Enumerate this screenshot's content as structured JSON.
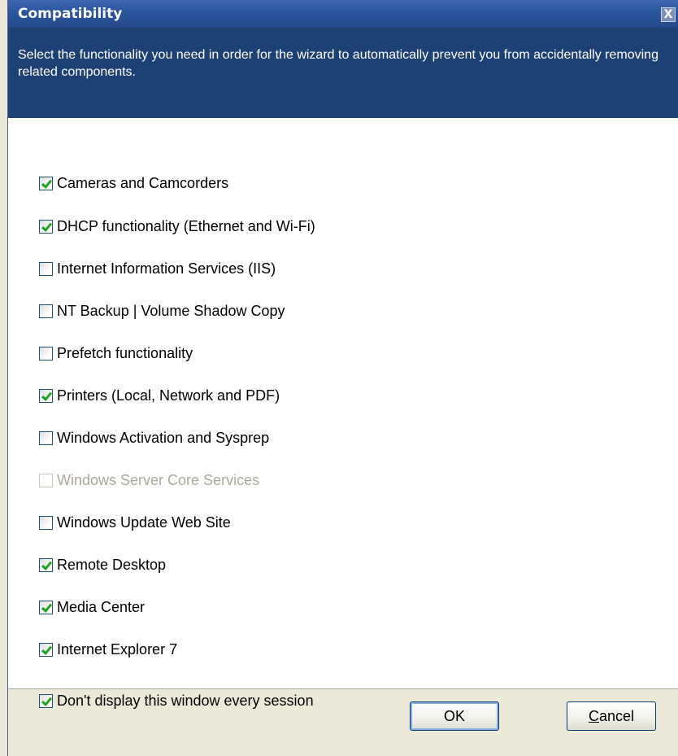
{
  "window": {
    "title": "Compatibility",
    "close_glyph": "X"
  },
  "header": {
    "text": "Select the functionality you need in order for the wizard to automatically prevent you from accidentally removing related components."
  },
  "options": [
    {
      "label": "Cameras and Camcorders",
      "checked": true,
      "enabled": true
    },
    {
      "label": "DHCP functionality (Ethernet and Wi-Fi)",
      "checked": true,
      "enabled": true
    },
    {
      "label": "Internet Information Services (IIS)",
      "checked": false,
      "enabled": true
    },
    {
      "label": "NT Backup | Volume Shadow Copy",
      "checked": false,
      "enabled": true
    },
    {
      "label": "Prefetch functionality",
      "checked": false,
      "enabled": true
    },
    {
      "label": "Printers (Local, Network and PDF)",
      "checked": true,
      "enabled": true
    },
    {
      "label": "Windows Activation and Sysprep",
      "checked": false,
      "enabled": true
    },
    {
      "label": "Windows Server Core Services",
      "checked": false,
      "enabled": false
    },
    {
      "label": "Windows Update Web Site",
      "checked": false,
      "enabled": true
    },
    {
      "label": "Remote Desktop",
      "checked": true,
      "enabled": true
    },
    {
      "label": "Media Center",
      "checked": true,
      "enabled": true
    },
    {
      "label": "Internet Explorer 7",
      "checked": true,
      "enabled": true
    }
  ],
  "footer": {
    "dont_display_label": "Don't display this window every session",
    "dont_display_checked": true,
    "ok_label": "OK",
    "cancel_label": "Cancel"
  },
  "colors": {
    "title_bar": "#2b579f",
    "header_bg": "#1d4174",
    "check_mark": "#21a121"
  }
}
